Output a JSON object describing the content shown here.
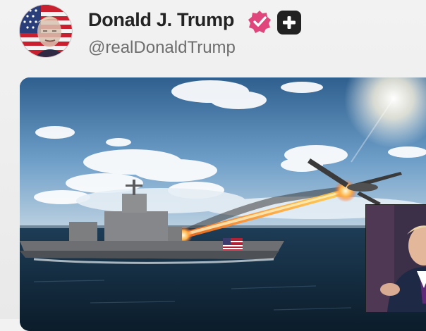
{
  "post": {
    "author": {
      "display_name": "Donald J. Trump",
      "handle": "@realDonaldTrump",
      "avatar": "flag-portrait-avatar",
      "badges": [
        "verified-badge-icon",
        "plus-badge-icon"
      ]
    },
    "media": {
      "type": "image",
      "scene": "warship-laser-drone",
      "inset": "video-thumbnail-person"
    }
  },
  "colors": {
    "verified": "#e0457b",
    "badge_dark": "#222222",
    "handle": "#6e6e6e",
    "name": "#232323"
  }
}
